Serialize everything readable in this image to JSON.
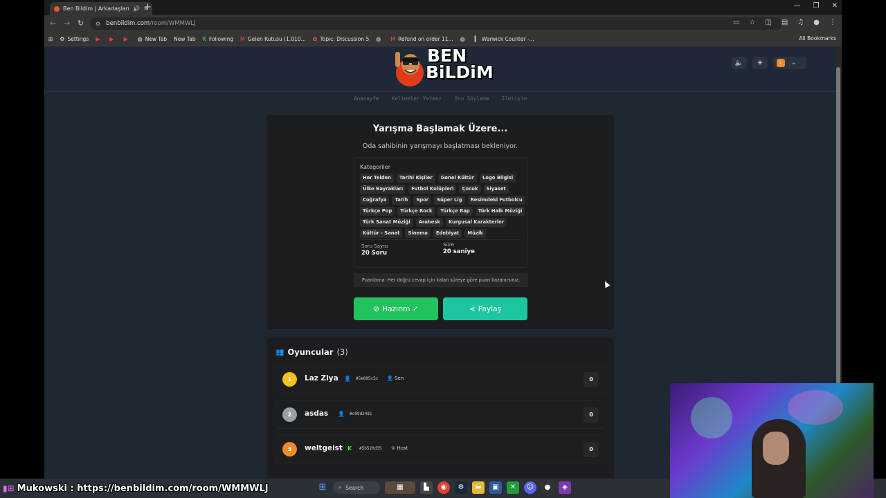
{
  "browser": {
    "tab_title": "Ben Bildim | Arkadaşlarınla",
    "new_tab_symbol": "+",
    "url_host": "benbildim.com",
    "url_path": "/room/WMMWLJ",
    "bookmarks": [
      {
        "label": "Settings",
        "icon": "gear-icon"
      },
      {
        "label": "",
        "icon": "youtube-icon"
      },
      {
        "label": "",
        "icon": "youtube-icon"
      },
      {
        "label": "",
        "icon": "youtube-icon"
      },
      {
        "label": "New Tab",
        "icon": "globe-icon"
      },
      {
        "label": "New Tab",
        "icon": "none"
      },
      {
        "label": "Following",
        "icon": "kick-icon"
      },
      {
        "label": "Gelen Kutusu (1.010...",
        "icon": "gmail-icon"
      },
      {
        "label": "Topic: Discussion 5",
        "icon": "leaf-icon"
      },
      {
        "label": "",
        "icon": "globe-icon"
      },
      {
        "label": "Refund on order 11...",
        "icon": "gmail-icon"
      },
      {
        "label": "",
        "icon": "globe-icon"
      },
      {
        "label": "Warwick Counter -...",
        "icon": "bar-icon"
      }
    ],
    "all_bookmarks": "All Bookmarks"
  },
  "site": {
    "logo_line1": "BEN",
    "logo_line2": "BiLDiM",
    "nav": [
      "Anasayfa",
      "Kelimeler Yetmez",
      "Onu Söyleme",
      "İletişim"
    ],
    "user_initial": "L"
  },
  "room": {
    "title": "Yarışma Başlamak Üzere...",
    "subtitle": "Oda sahibinin yarışmayı başlatması bekleniyor.",
    "categories_label": "Kategoriler",
    "categories": [
      "Her Telden",
      "Tarihi Kişiler",
      "Genel Kültür",
      "Logo Bilgisi",
      "Ülke Bayrakları",
      "Futbol Kulüpleri",
      "Çocuk",
      "Siyaset",
      "Coğrafya",
      "Tarih",
      "Spor",
      "Süper Lig",
      "Resimdeki Futbolcu",
      "Türkçe Pop",
      "Türkçe Rock",
      "Türkçe Rap",
      "Türk Halk Müziği",
      "Türk Sanat Müziği",
      "Arabesk",
      "Kurgusal Karakterler",
      "Kültür - Sanat",
      "Sinema",
      "Edebiyat",
      "Müzik"
    ],
    "question_count_label": "Soru Sayısı",
    "question_count_value": "20 Soru",
    "duration_label": "Süre",
    "duration_value": "20 saniye",
    "scoring_note": "Puanlama: Her doğru cevap için kalan süreye göre puan kazanırsınız.",
    "ready_button": "Hazırım ✓",
    "share_button": "Paylaş"
  },
  "players": {
    "title": "Oyuncular",
    "count": "(3)",
    "list": [
      {
        "rank": "1",
        "name": "Laz Ziya",
        "id": "#5e895c5c",
        "tag": "Sen",
        "score": "0",
        "rank_color": "#f2c21b"
      },
      {
        "rank": "2",
        "name": "asdas",
        "id": "#c09d3481",
        "tag": "",
        "score": "0",
        "rank_color": "#9aa0a8"
      },
      {
        "rank": "3",
        "name": "weltgeist",
        "id": "#5b520d35",
        "tag": "Host",
        "score": "0",
        "rank_color": "#f08a2a"
      }
    ]
  },
  "overlay": {
    "ticker_text": "Mukowski : https://benbildim.com/room/WMMWLJ"
  },
  "taskbar": {
    "search_label": "Search"
  }
}
